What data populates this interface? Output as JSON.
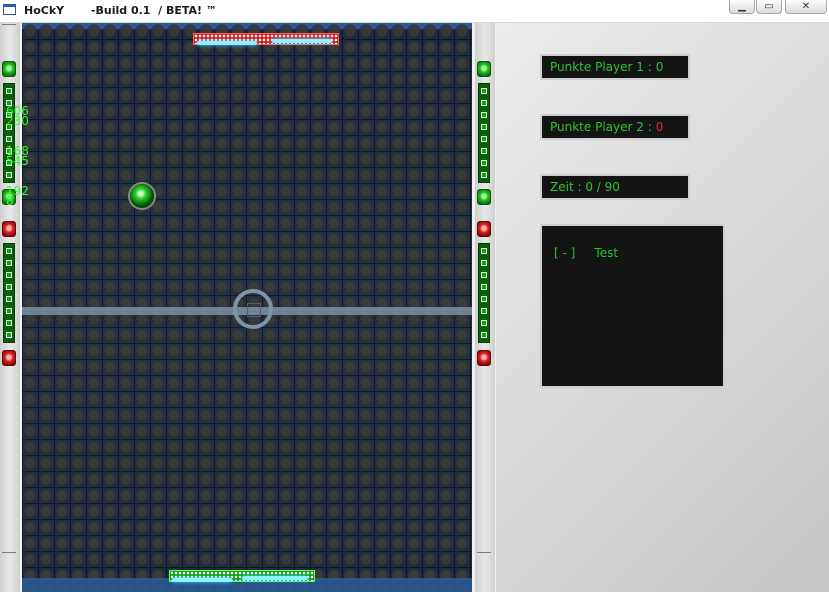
{
  "window": {
    "title": "HoCkY       -Build 0.1  / BETA! ™",
    "controls": {
      "minimize_icon": "minimize-icon",
      "maximize_icon": "maximize-icon",
      "close_icon": "close-icon"
    }
  },
  "debug": {
    "lines": [
      "606",
      "230",
      "168",
      "545",
      "192",
      "8"
    ]
  },
  "scoreboard": {
    "player1_label": "Punkte Player 1 :",
    "player1_score": "0",
    "player2_label": "Punkte Player 2 :",
    "player2_score": "0",
    "time_label": "Zeit : 0 / 90"
  },
  "log": {
    "prefix": "[ - ]",
    "message": "Test"
  },
  "colors": {
    "player1": "#2ec42e",
    "player2": "#e02424",
    "board": "#1b3f6a",
    "panel_text": "#2ec42e"
  }
}
